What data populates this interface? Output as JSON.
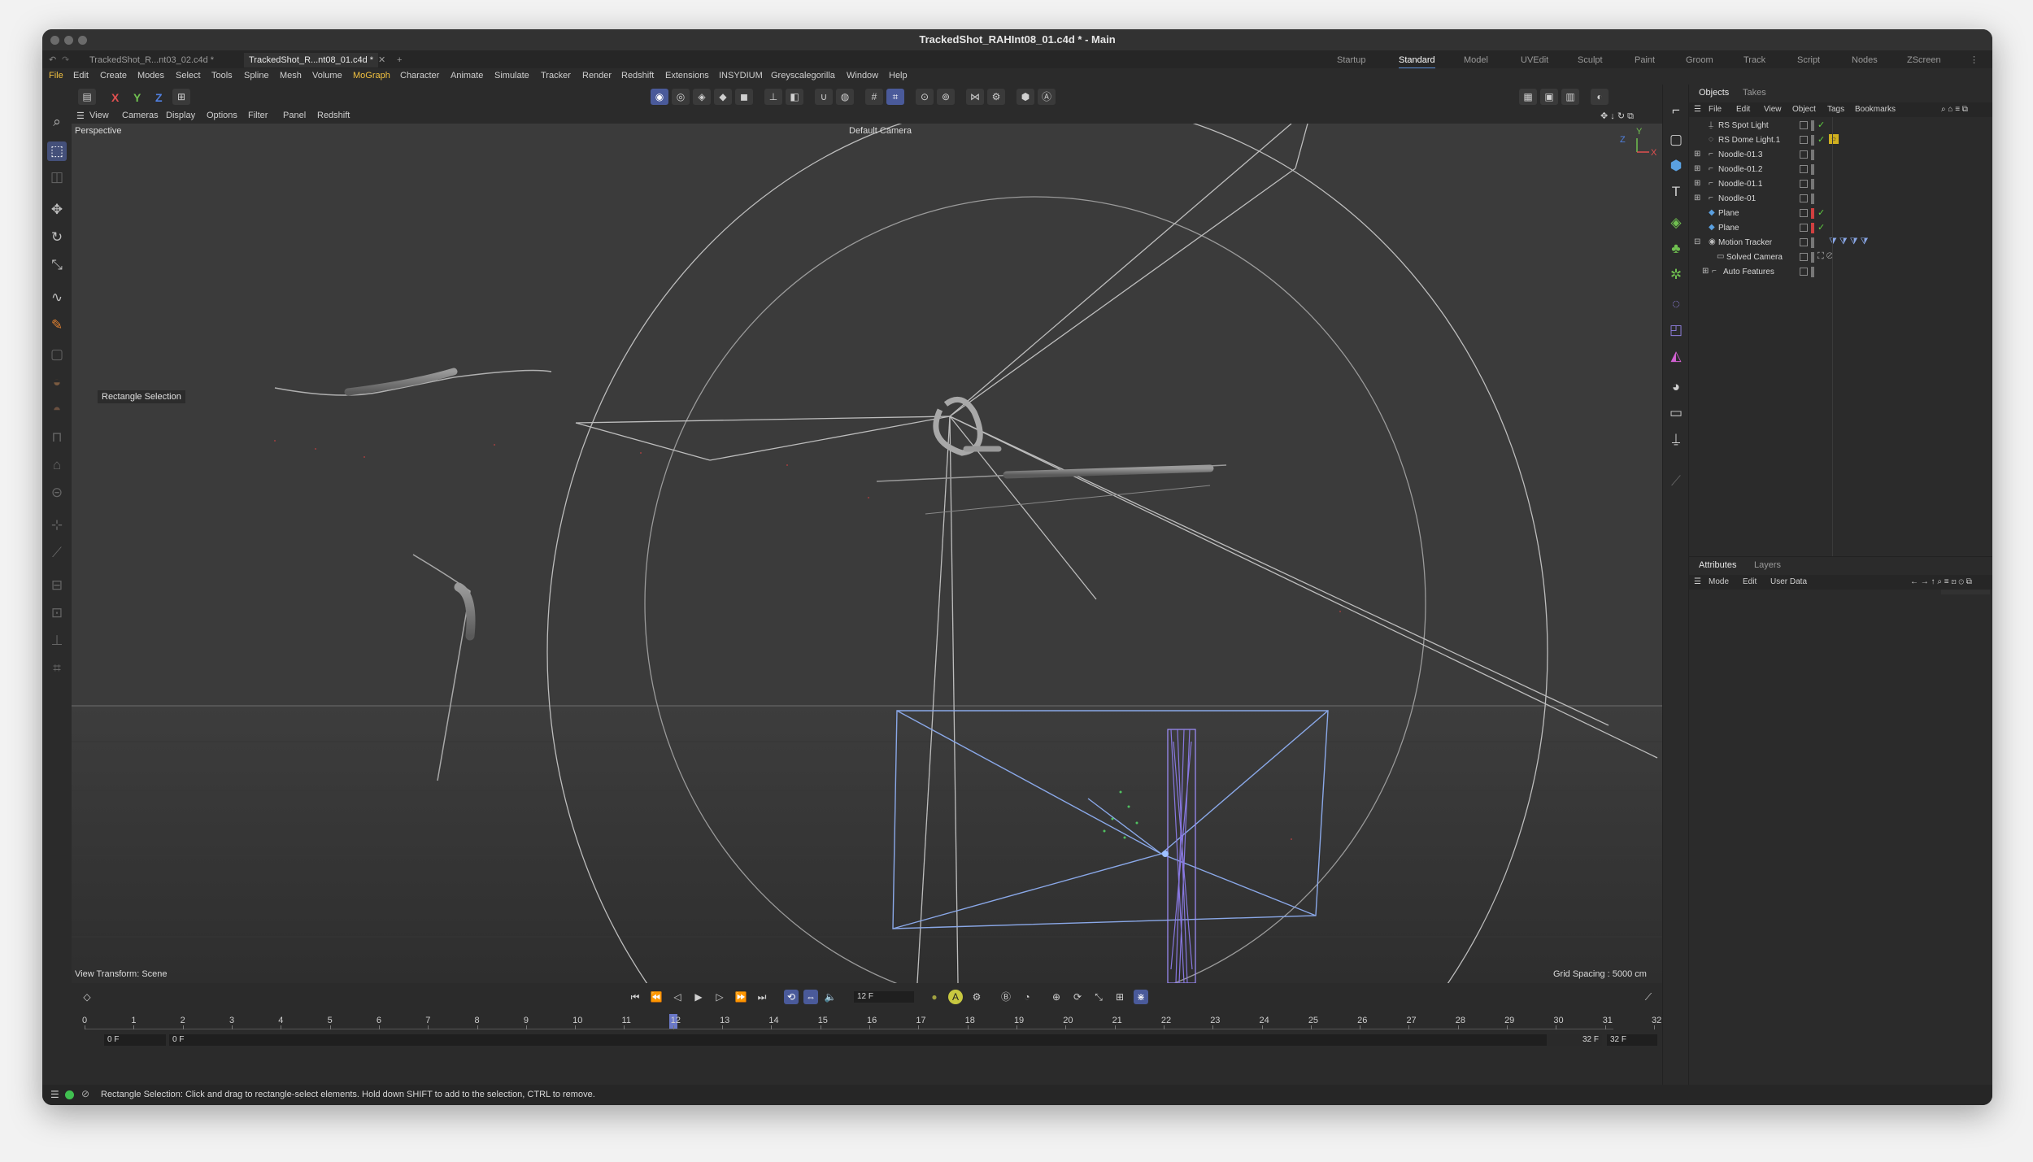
{
  "window": {
    "title": "TrackedShot_RAHInt08_01.c4d * - Main"
  },
  "doc_tabs": [
    {
      "label": "TrackedShot_R...nt03_02.c4d *"
    },
    {
      "label": "TrackedShot_R...nt08_01.c4d *"
    }
  ],
  "layouts": [
    "Startup",
    "Standard",
    "Model",
    "UVEdit",
    "Sculpt",
    "Paint",
    "Groom",
    "Track",
    "Script",
    "Nodes",
    "ZScreen"
  ],
  "menu": [
    "File",
    "Edit",
    "Create",
    "Modes",
    "Select",
    "Tools",
    "Spline",
    "Mesh",
    "Volume",
    "MoGraph",
    "Character",
    "Animate",
    "Simulate",
    "Tracker",
    "Render",
    "Redshift",
    "Extensions",
    "INSYDIUM",
    "Greyscalegorilla",
    "Window",
    "Help"
  ],
  "axes": {
    "x": "X",
    "y": "Y",
    "z": "Z"
  },
  "view_menu": [
    "View",
    "Cameras",
    "Display",
    "Options",
    "Filter",
    "Panel",
    "Redshift"
  ],
  "viewport": {
    "name": "Perspective",
    "camera": "Default Camera",
    "view_transform": "View Transform: Scene",
    "grid_spacing": "Grid Spacing : 5000 cm",
    "tool_label": "Rectangle Selection",
    "axis_y": "Y",
    "axis_x": "X",
    "axis_z": "Z"
  },
  "objects_panel": {
    "tabs": [
      "Objects",
      "Takes"
    ],
    "menu": [
      "File",
      "Edit",
      "View",
      "Object",
      "Tags",
      "Bookmarks"
    ],
    "items": [
      {
        "name": "RS Spot Light"
      },
      {
        "name": "RS Dome Light.1"
      },
      {
        "name": "Noodle-01.3"
      },
      {
        "name": "Noodle-01.2"
      },
      {
        "name": "Noodle-01.1"
      },
      {
        "name": "Noodle-01"
      },
      {
        "name": "Plane"
      },
      {
        "name": "Plane"
      },
      {
        "name": "Motion Tracker"
      },
      {
        "name": "Solved Camera"
      },
      {
        "name": "Auto Features"
      }
    ]
  },
  "attributes_panel": {
    "tabs": [
      "Attributes",
      "Layers"
    ],
    "menu": [
      "Mode",
      "Edit",
      "User Data"
    ]
  },
  "timeline": {
    "current_frame": "12 F",
    "start_a": "0 F",
    "start_b": "0 F",
    "end_a": "32 F",
    "end_b": "32 F",
    "ticks": [
      "0",
      "1",
      "2",
      "3",
      "4",
      "5",
      "6",
      "7",
      "8",
      "9",
      "10",
      "11",
      "12",
      "13",
      "14",
      "15",
      "16",
      "17",
      "18",
      "19",
      "20",
      "21",
      "22",
      "23",
      "24",
      "25",
      "26",
      "27",
      "28",
      "29",
      "30",
      "31",
      "32"
    ],
    "playhead": 12
  },
  "status": {
    "text": "Rectangle Selection: Click and drag to rectangle-select elements. Hold down SHIFT to add to the selection, CTRL to remove."
  }
}
